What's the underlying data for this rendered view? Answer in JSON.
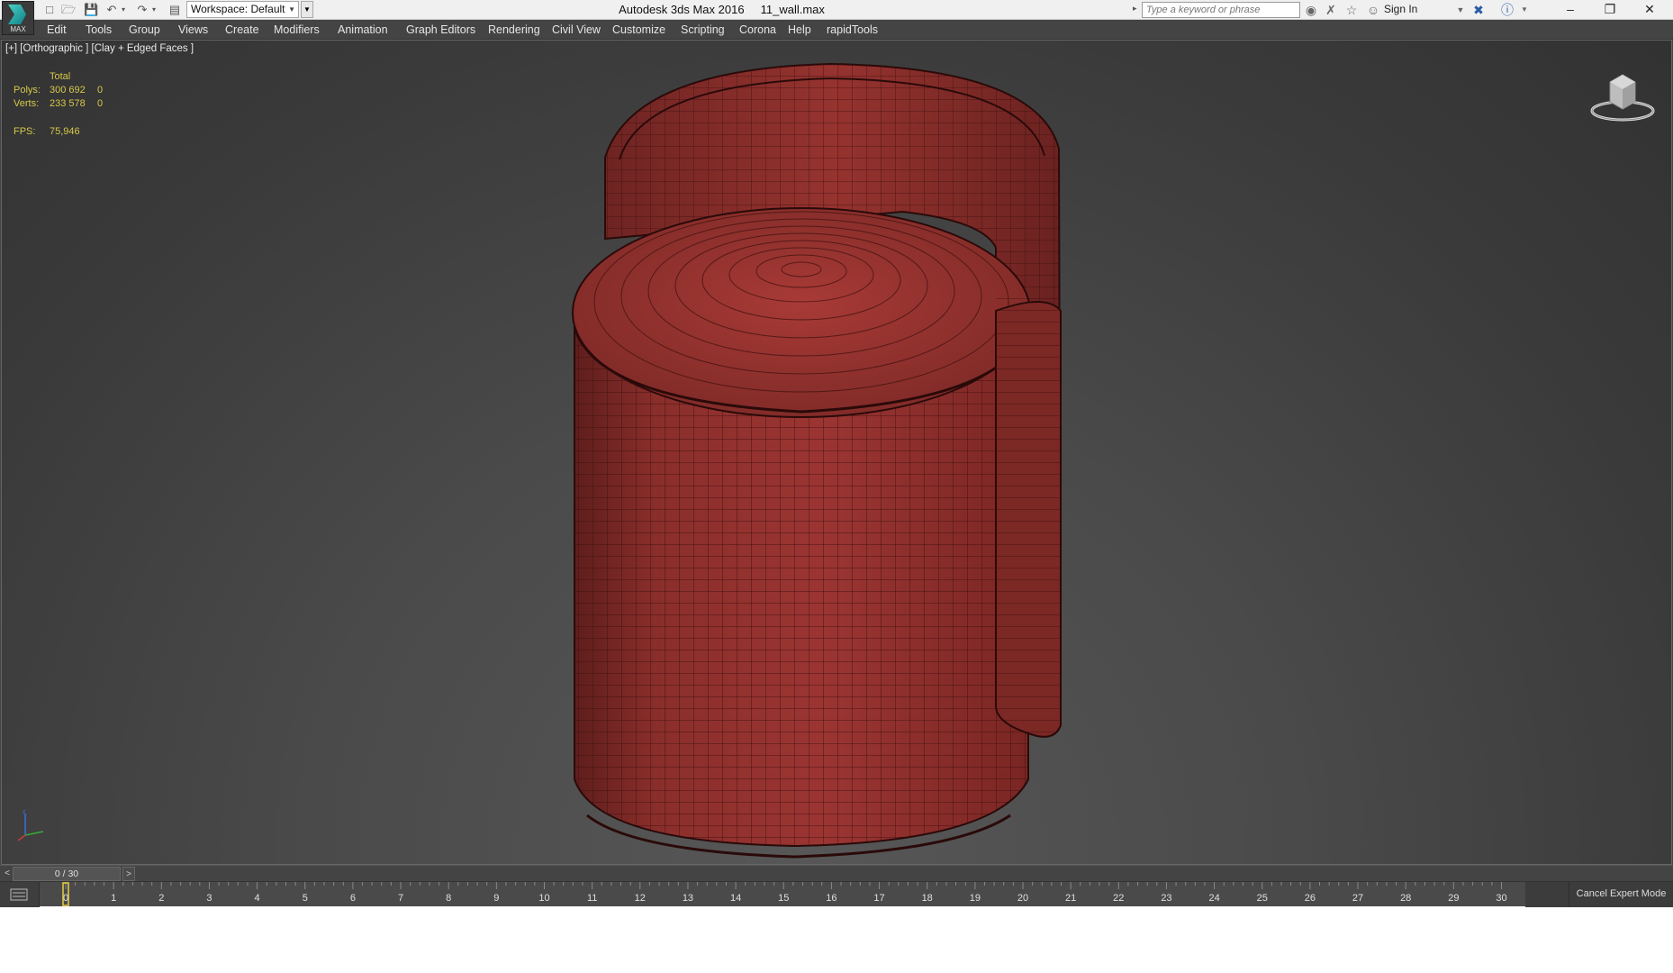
{
  "app": {
    "logo_label": "MAX"
  },
  "titlebar": {
    "workspace": "Workspace: Default",
    "title": "Autodesk 3ds Max 2016     11_wall.max",
    "search_placeholder": "Type a keyword or phrase",
    "sign_in": "Sign In"
  },
  "menu": [
    {
      "label": "Edit"
    },
    {
      "label": "Tools"
    },
    {
      "label": "Group"
    },
    {
      "label": "Views"
    },
    {
      "label": "Create"
    },
    {
      "label": "Modifiers"
    },
    {
      "label": "Animation"
    },
    {
      "label": "Graph Editors"
    },
    {
      "label": "Rendering"
    },
    {
      "label": "Civil View"
    },
    {
      "label": "Customize"
    },
    {
      "label": "Scripting"
    },
    {
      "label": "Corona"
    },
    {
      "label": "Help"
    },
    {
      "label": "rapidTools"
    }
  ],
  "viewport": {
    "label": "[+] [Orthographic ] [Clay + Edged Faces ]",
    "stats": {
      "total_label": "Total",
      "polys_label": "Polys:",
      "polys_value": "300 692",
      "polys_sel": "0",
      "verts_label": "Verts:",
      "verts_value": "233 578",
      "verts_sel": "0",
      "fps_label": "FPS:",
      "fps_value": "75,946"
    },
    "colors": {
      "model": "#8e2e2b",
      "stats_text": "#d6c84a"
    }
  },
  "timeline": {
    "slider_label": "0 / 30",
    "prev": "<",
    "next": ">",
    "current_frame": 0,
    "frames": [
      "0",
      "1",
      "2",
      "3",
      "4",
      "5",
      "6",
      "7",
      "8",
      "9",
      "10",
      "11",
      "12",
      "13",
      "14",
      "15",
      "16",
      "17",
      "18",
      "19",
      "20",
      "21",
      "22",
      "23",
      "24",
      "25",
      "26",
      "27",
      "28",
      "29",
      "30"
    ],
    "cancel_expert": "Cancel Expert Mode"
  },
  "icons": [
    "3dsmax-logo-icon",
    "new-file-icon",
    "open-file-icon",
    "save-icon",
    "undo-icon",
    "redo-icon",
    "project-folder-icon",
    "binoculars-icon",
    "tools-icon",
    "star-icon",
    "user-icon",
    "close-x-icon",
    "help-icon",
    "viewcube-icon",
    "axis-tripod-icon"
  ]
}
